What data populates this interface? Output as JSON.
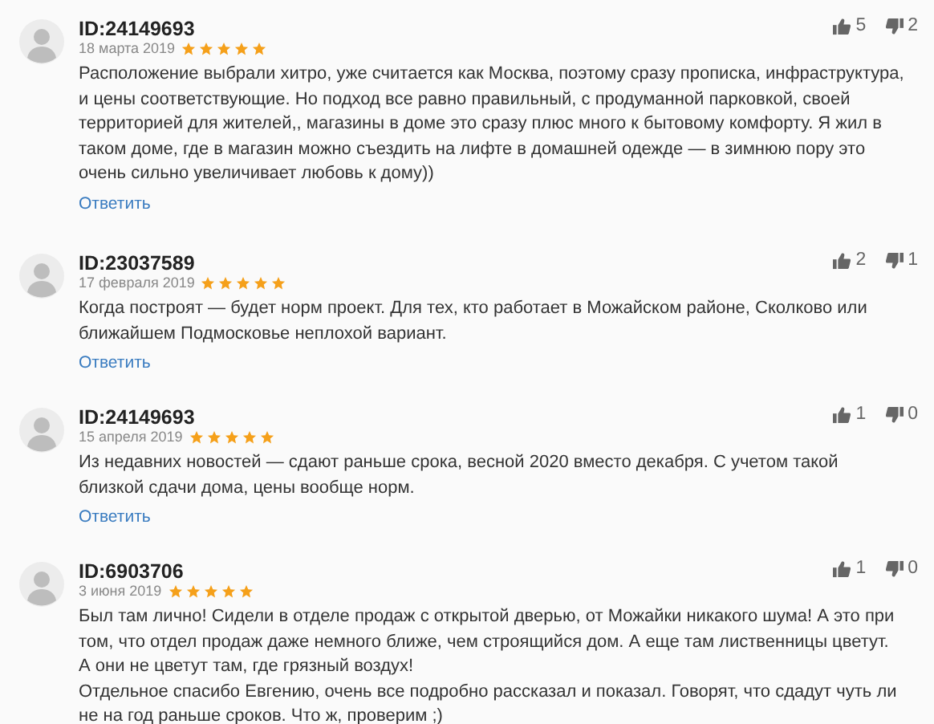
{
  "reviews": [
    {
      "author": "ID:24149693",
      "date": "18 марта 2019",
      "stars": 5,
      "likes": "5",
      "dislikes": "2",
      "text": "Расположение выбрали хитро, уже считается как Москва, поэтому сразу прописка, инфраструктура, и цены соответствующие. Но подход все равно правильный, с продуманной парковкой, своей территорией для жителей,, магазины в доме это сразу плюс много к бытовому комфорту. Я жил в таком доме, где в магазин можно съездить на лифте в домашней одежде — в зимнюю пору это очень сильно увеличивает любовь к дому))",
      "reply": "Ответить"
    },
    {
      "author": "ID:23037589",
      "date": "17 февраля 2019",
      "stars": 5,
      "likes": "2",
      "dislikes": "1",
      "text": "Когда построят — будет норм проект. Для тех, кто работает в Можайском районе, Сколково или ближайшем Подмосковье неплохой вариант.",
      "reply": "Ответить"
    },
    {
      "author": "ID:24149693",
      "date": "15 апреля 2019",
      "stars": 5,
      "likes": "1",
      "dislikes": "0",
      "text": "Из недавних новостей — сдают раньше срока, весной 2020 вместо декабря. С учетом такой близкой сдачи дома, цены вообще норм.",
      "reply": "Ответить"
    },
    {
      "author": "ID:6903706",
      "date": "3 июня 2019",
      "stars": 5,
      "likes": "1",
      "dislikes": "0",
      "text": "Был там лично! Сидели в отделе продаж с открытой дверью, от Можайки никакого шума! А это при том, что отдел продаж даже немного ближе, чем строящийся дом. А еще там лиственницы цветут. А они не цветут там, где грязный воздух!\nОтдельное спасибо Евгению, очень все подробно рассказал и показал. Говорят, что сдадут чуть ли не на год раньше сроков. Что ж, проверим ;)"
    }
  ]
}
